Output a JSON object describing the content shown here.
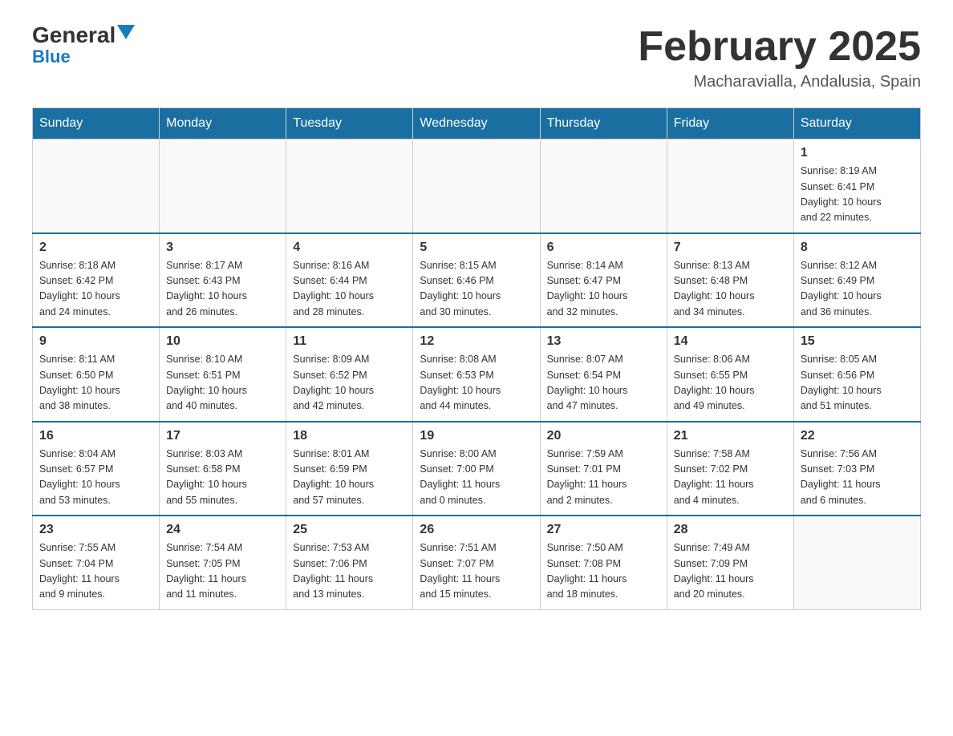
{
  "logo": {
    "general": "General",
    "blue": "Blue"
  },
  "title": "February 2025",
  "location": "Macharavialla, Andalusia, Spain",
  "days_of_week": [
    "Sunday",
    "Monday",
    "Tuesday",
    "Wednesday",
    "Thursday",
    "Friday",
    "Saturday"
  ],
  "weeks": [
    [
      {
        "day": "",
        "info": ""
      },
      {
        "day": "",
        "info": ""
      },
      {
        "day": "",
        "info": ""
      },
      {
        "day": "",
        "info": ""
      },
      {
        "day": "",
        "info": ""
      },
      {
        "day": "",
        "info": ""
      },
      {
        "day": "1",
        "info": "Sunrise: 8:19 AM\nSunset: 6:41 PM\nDaylight: 10 hours\nand 22 minutes."
      }
    ],
    [
      {
        "day": "2",
        "info": "Sunrise: 8:18 AM\nSunset: 6:42 PM\nDaylight: 10 hours\nand 24 minutes."
      },
      {
        "day": "3",
        "info": "Sunrise: 8:17 AM\nSunset: 6:43 PM\nDaylight: 10 hours\nand 26 minutes."
      },
      {
        "day": "4",
        "info": "Sunrise: 8:16 AM\nSunset: 6:44 PM\nDaylight: 10 hours\nand 28 minutes."
      },
      {
        "day": "5",
        "info": "Sunrise: 8:15 AM\nSunset: 6:46 PM\nDaylight: 10 hours\nand 30 minutes."
      },
      {
        "day": "6",
        "info": "Sunrise: 8:14 AM\nSunset: 6:47 PM\nDaylight: 10 hours\nand 32 minutes."
      },
      {
        "day": "7",
        "info": "Sunrise: 8:13 AM\nSunset: 6:48 PM\nDaylight: 10 hours\nand 34 minutes."
      },
      {
        "day": "8",
        "info": "Sunrise: 8:12 AM\nSunset: 6:49 PM\nDaylight: 10 hours\nand 36 minutes."
      }
    ],
    [
      {
        "day": "9",
        "info": "Sunrise: 8:11 AM\nSunset: 6:50 PM\nDaylight: 10 hours\nand 38 minutes."
      },
      {
        "day": "10",
        "info": "Sunrise: 8:10 AM\nSunset: 6:51 PM\nDaylight: 10 hours\nand 40 minutes."
      },
      {
        "day": "11",
        "info": "Sunrise: 8:09 AM\nSunset: 6:52 PM\nDaylight: 10 hours\nand 42 minutes."
      },
      {
        "day": "12",
        "info": "Sunrise: 8:08 AM\nSunset: 6:53 PM\nDaylight: 10 hours\nand 44 minutes."
      },
      {
        "day": "13",
        "info": "Sunrise: 8:07 AM\nSunset: 6:54 PM\nDaylight: 10 hours\nand 47 minutes."
      },
      {
        "day": "14",
        "info": "Sunrise: 8:06 AM\nSunset: 6:55 PM\nDaylight: 10 hours\nand 49 minutes."
      },
      {
        "day": "15",
        "info": "Sunrise: 8:05 AM\nSunset: 6:56 PM\nDaylight: 10 hours\nand 51 minutes."
      }
    ],
    [
      {
        "day": "16",
        "info": "Sunrise: 8:04 AM\nSunset: 6:57 PM\nDaylight: 10 hours\nand 53 minutes."
      },
      {
        "day": "17",
        "info": "Sunrise: 8:03 AM\nSunset: 6:58 PM\nDaylight: 10 hours\nand 55 minutes."
      },
      {
        "day": "18",
        "info": "Sunrise: 8:01 AM\nSunset: 6:59 PM\nDaylight: 10 hours\nand 57 minutes."
      },
      {
        "day": "19",
        "info": "Sunrise: 8:00 AM\nSunset: 7:00 PM\nDaylight: 11 hours\nand 0 minutes."
      },
      {
        "day": "20",
        "info": "Sunrise: 7:59 AM\nSunset: 7:01 PM\nDaylight: 11 hours\nand 2 minutes."
      },
      {
        "day": "21",
        "info": "Sunrise: 7:58 AM\nSunset: 7:02 PM\nDaylight: 11 hours\nand 4 minutes."
      },
      {
        "day": "22",
        "info": "Sunrise: 7:56 AM\nSunset: 7:03 PM\nDaylight: 11 hours\nand 6 minutes."
      }
    ],
    [
      {
        "day": "23",
        "info": "Sunrise: 7:55 AM\nSunset: 7:04 PM\nDaylight: 11 hours\nand 9 minutes."
      },
      {
        "day": "24",
        "info": "Sunrise: 7:54 AM\nSunset: 7:05 PM\nDaylight: 11 hours\nand 11 minutes."
      },
      {
        "day": "25",
        "info": "Sunrise: 7:53 AM\nSunset: 7:06 PM\nDaylight: 11 hours\nand 13 minutes."
      },
      {
        "day": "26",
        "info": "Sunrise: 7:51 AM\nSunset: 7:07 PM\nDaylight: 11 hours\nand 15 minutes."
      },
      {
        "day": "27",
        "info": "Sunrise: 7:50 AM\nSunset: 7:08 PM\nDaylight: 11 hours\nand 18 minutes."
      },
      {
        "day": "28",
        "info": "Sunrise: 7:49 AM\nSunset: 7:09 PM\nDaylight: 11 hours\nand 20 minutes."
      },
      {
        "day": "",
        "info": ""
      }
    ]
  ]
}
